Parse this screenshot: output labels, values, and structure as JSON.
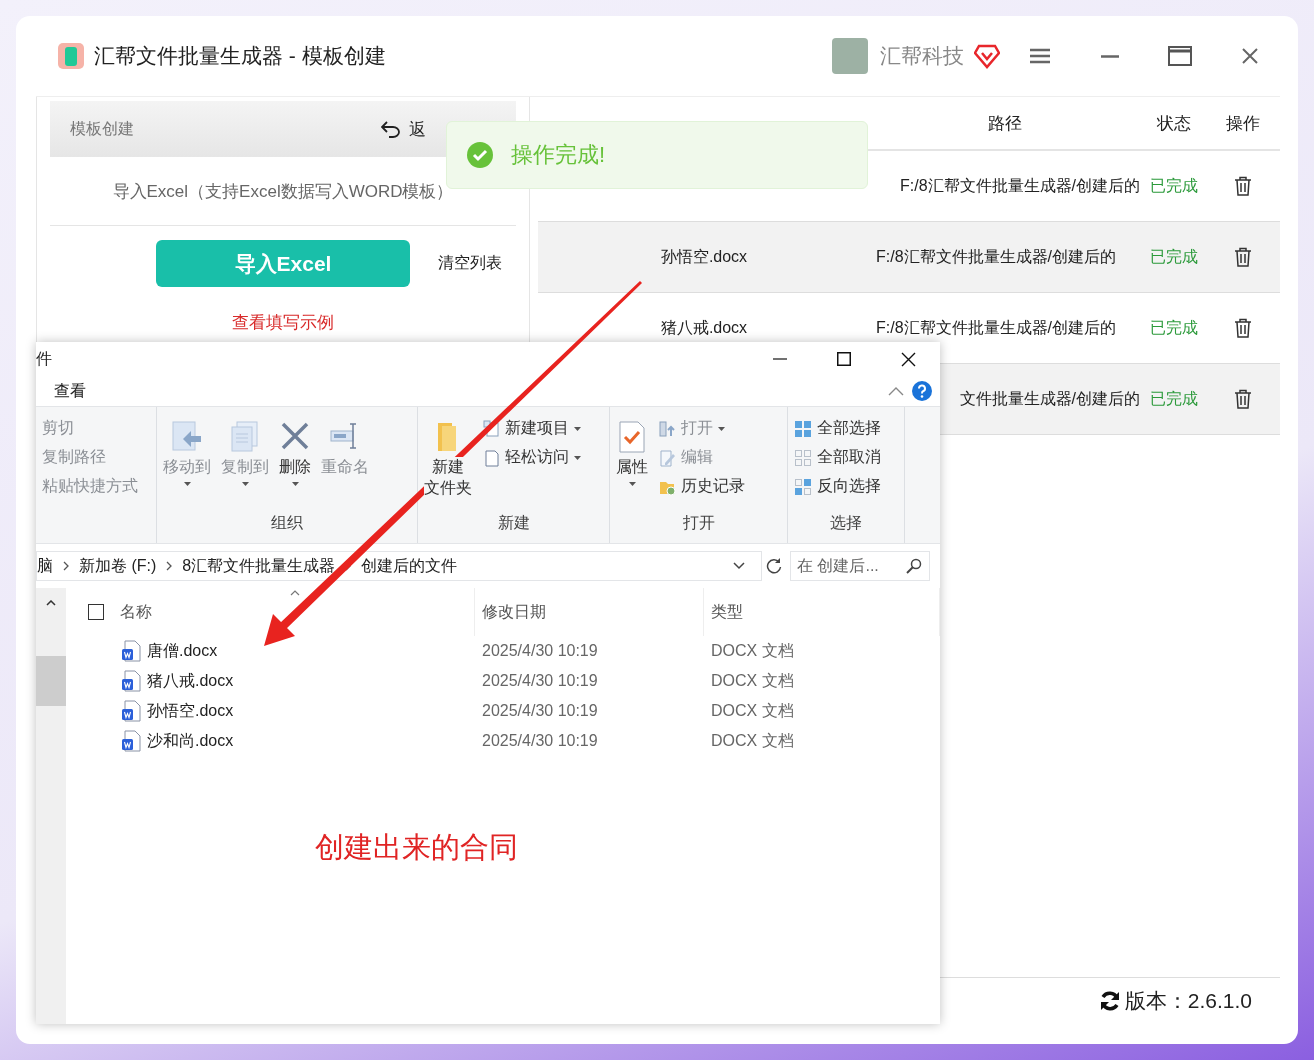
{
  "app": {
    "title": "汇帮文件批量生成器 - 模板创建",
    "user": "汇帮科技"
  },
  "left_panel": {
    "header": "模板创建",
    "back": "返",
    "description": "导入Excel（支持Excel数据写入WORD模板）",
    "import_button": "导入Excel",
    "clear_button": "清空列表",
    "example_link": "查看填写示例"
  },
  "file_table": {
    "columns": [
      "路径",
      "状态",
      "操作"
    ],
    "rows": [
      {
        "path": "F:/8汇帮文件批量生成器/创建后的",
        "status": "已完成"
      },
      {
        "name": "孙悟空.docx",
        "path": "F:/8汇帮文件批量生成器/创建后的",
        "status": "已完成"
      },
      {
        "name": "猪八戒.docx",
        "path": "F:/8汇帮文件批量生成器/创建后的",
        "status": "已完成"
      },
      {
        "path": "文件批量生成器/创建后的",
        "status": "已完成"
      }
    ]
  },
  "status_bar": {
    "version": "版本：2.6.1.0"
  },
  "toast": {
    "message": "操作完成!"
  },
  "explorer": {
    "title": "件",
    "ribbon_tab": "查看",
    "groups": [
      {
        "items": [
          {
            "label": "剪切",
            "kind": "small",
            "disabled": true,
            "has_menu": false
          },
          {
            "label": "复制路径",
            "kind": "small",
            "disabled": true,
            "has_menu": false
          },
          {
            "label": "粘贴快捷方式",
            "kind": "small",
            "disabled": true,
            "has_menu": false
          }
        ]
      },
      {
        "label": "组织",
        "items": [
          {
            "label": "移动到",
            "kind": "large",
            "disabled": true,
            "has_menu": true
          },
          {
            "label": "复制到",
            "kind": "large",
            "disabled": true,
            "has_menu": true
          },
          {
            "label": "删除",
            "kind": "large",
            "disabled": false,
            "has_menu": true
          },
          {
            "label": "重命名",
            "kind": "large",
            "disabled": true,
            "has_menu": false
          }
        ]
      },
      {
        "label": "新建",
        "items": [
          {
            "label_lines": [
              "新建",
              "文件夹"
            ],
            "kind": "large",
            "disabled": false,
            "has_menu": false
          },
          {
            "label": "新建项目",
            "kind": "small",
            "disabled": false,
            "has_menu": true
          },
          {
            "label": "轻松访问",
            "kind": "small",
            "disabled": false,
            "has_menu": true
          }
        ]
      },
      {
        "label": "打开",
        "items": [
          {
            "label": "属性",
            "kind": "large",
            "disabled": false,
            "has_menu": true
          },
          {
            "label": "打开",
            "kind": "small",
            "disabled": true,
            "has_menu": true
          },
          {
            "label": "编辑",
            "kind": "small",
            "disabled": true,
            "has_menu": false
          },
          {
            "label": "历史记录",
            "kind": "small",
            "disabled": false,
            "has_menu": false
          }
        ]
      },
      {
        "label": "选择",
        "items": [
          {
            "label": "全部选择",
            "kind": "small",
            "disabled": false,
            "has_menu": false
          },
          {
            "label": "全部取消",
            "kind": "small",
            "disabled": false,
            "has_menu": false
          },
          {
            "label": "反向选择",
            "kind": "small",
            "disabled": false,
            "has_menu": false
          }
        ]
      }
    ],
    "breadcrumb": [
      "脑",
      "新加卷 (F:)",
      "8汇帮文件批量生成器",
      "创建后的文件"
    ],
    "search_placeholder": "在 创建后...",
    "select_all_checked": false,
    "columns": [
      "名称",
      "修改日期",
      "类型"
    ],
    "files": [
      {
        "name": "唐僧.docx",
        "date": "2025/4/30 10:19",
        "type": "DOCX 文档"
      },
      {
        "name": "猪八戒.docx",
        "date": "2025/4/30 10:19",
        "type": "DOCX 文档"
      },
      {
        "name": "孙悟空.docx",
        "date": "2025/4/30 10:19",
        "type": "DOCX 文档"
      },
      {
        "name": "沙和尚.docx",
        "date": "2025/4/30 10:19",
        "type": "DOCX 文档"
      }
    ],
    "annotation": "创建出来的合同"
  }
}
